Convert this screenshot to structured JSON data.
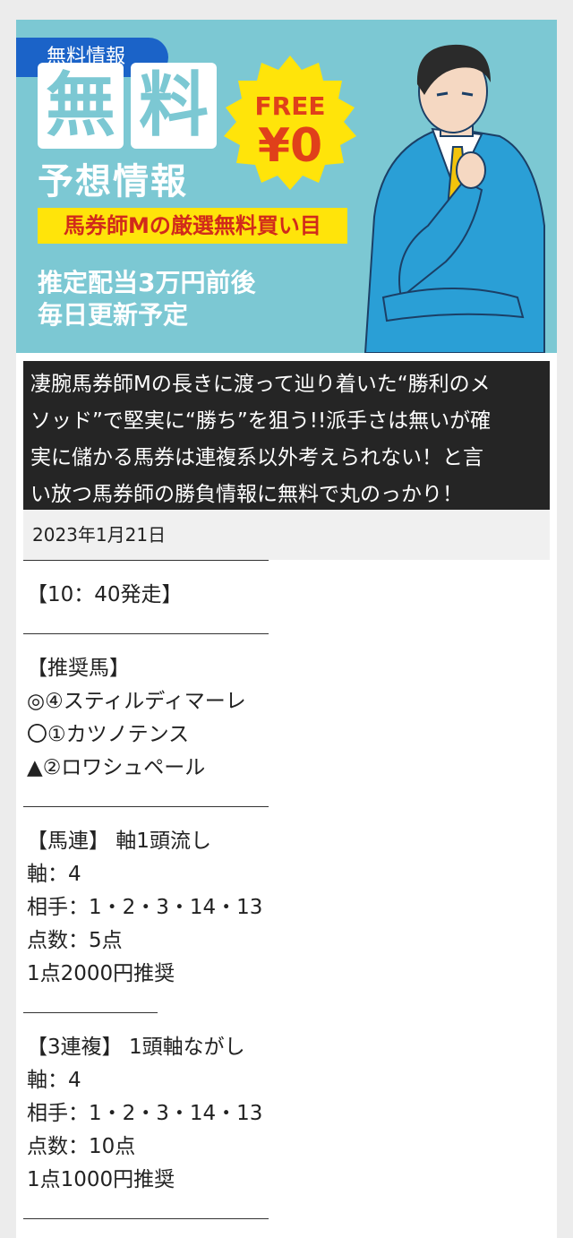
{
  "banner": {
    "tag": "無料情報",
    "big_chars": [
      "無",
      "料"
    ],
    "subtitle": "予想情報",
    "highlight": "馬券師Mの厳選無料買い目",
    "lines": [
      "推定配当3万円前後",
      "毎日更新予定"
    ],
    "badge_top": "FREE",
    "badge_bottom": "¥0"
  },
  "intro_lines": [
    "凄腕馬券師Mの長きに渡って辿り着いた“勝利のメ",
    "ソッド”で堅実に“勝ち”を狙う!!派手さは無いが確",
    "実に儲かる馬券は連複系以外考えられない！と言",
    "い放つ馬券師の勝負情報に無料で丸のっかり！"
  ],
  "date": "2023年1月21日",
  "sections": [
    {
      "lines": [
        "【10：40発走】"
      ]
    },
    {
      "lines": [
        "【推奨馬】",
        "◎④スティルディマーレ",
        "〇①カツノテンス",
        "▲②ロワシュペール"
      ]
    },
    {
      "lines": [
        "【馬連】 軸1頭流し",
        "軸：4",
        "相手：1・2・3・14・13",
        "点数：5点",
        "1点2000円推奨"
      ]
    },
    {
      "lines": [
        "【3連複】 1頭軸ながし",
        "軸：4",
        "相手：1・2・3・14・13",
        "点数：10点",
        "1点1000円推奨"
      ]
    }
  ],
  "colors": {
    "banner_bg": "#7cc8d3",
    "tag_bg": "#1b63c8",
    "badge": "#ffe40a",
    "highlight_text": "#d12a1b",
    "suit": "#2a9fd6"
  }
}
